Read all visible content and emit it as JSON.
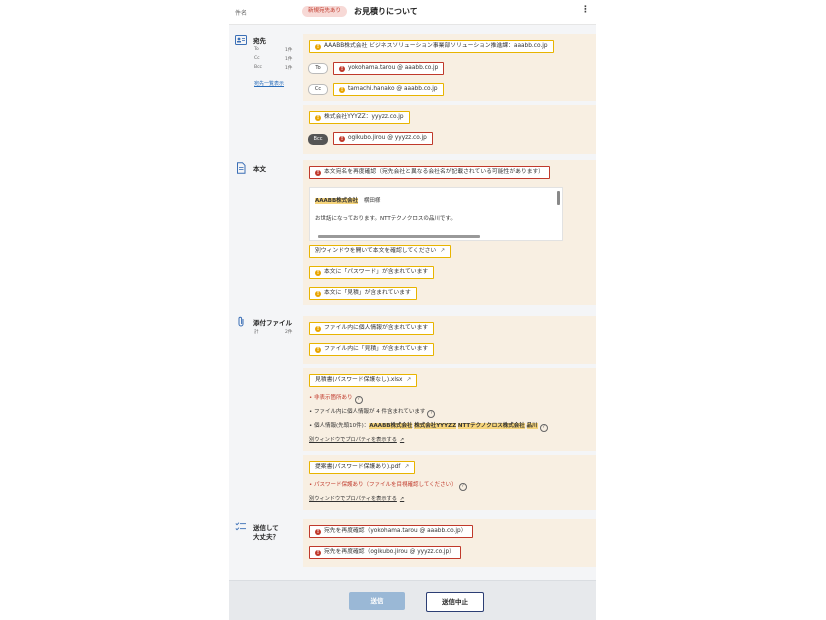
{
  "header": {
    "subject_key": "件名",
    "badge": "新規宛先あり",
    "subject": "お見積りについて",
    "more": "⋮"
  },
  "recipients": {
    "title": "宛先",
    "to_label": "To",
    "to_count": "1件",
    "cc_label": "Cc",
    "cc_count": "1件",
    "bcc_label": "Bcc",
    "bcc_count": "1件",
    "list_link": "宛先一覧表示",
    "group1_header": "AAABB株式会社 ビジネスソリューション事業部ソリューション推進課：aaabb.co.jp",
    "to_pill": "To",
    "to_addr": "yokohama.tarou @ aaabb.co.jp",
    "cc_pill": "Cc",
    "cc_addr": "tamachi.hanako @ aaabb.co.jp",
    "group2_header": "株式会社YYYZZ：yyyzz.co.jp",
    "bcc_pill": "Bcc",
    "bcc_addr": "ogikubo.jirou @ yyyzz.co.jp"
  },
  "body": {
    "title": "本文",
    "warning": "本文宛名を再度確認（宛先会社と異なる会社名が記載されている可能性があります）",
    "preview_company": "AAABB株式会社",
    "preview_name": "横田様",
    "preview_line": "お世話になっております。NTTテクノクロスの品川です。",
    "open_window": "別ウィンドウを開いて本文を確認してください",
    "pw_warning": "本文に「パスワード」が含まれています",
    "quote_warning": "本文に「見積」が含まれています"
  },
  "attachments": {
    "title": "添付ファイル",
    "total_label": "計",
    "total_count": "2件",
    "warn_personal": "ファイル内に個人情報が含まれています",
    "warn_quote": "ファイル内に「見積」が含まれています",
    "file1": {
      "name": "見積書(パスワード保護なし).xlsx",
      "hidden": "非表示箇所あり",
      "personal_count": "ファイル内に個人情報が 4 件含まれています",
      "personal_prefix": "個人情報(先頭10件)：",
      "tags": [
        "AAABB株式会社",
        "株式会社YYYZZ",
        "NTTテクノクロス株式会社",
        "品川"
      ],
      "prop_link": "別ウィンドウでプロパティを表示する"
    },
    "file2": {
      "name": "提案書(パスワード保護あり).pdf",
      "pw_note": "パスワード保護あり（ファイルを目視確認してください）",
      "prop_link": "別ウィンドウでプロパティを表示する"
    }
  },
  "confirm": {
    "title_line1": "送信して",
    "title_line2": "大丈夫？",
    "check1": "宛先を再度確認（yokohama.tarou @ aaabb.co.jp）",
    "check2": "宛先を再度確認（ogikubo.jirou @ yyyzz.co.jp）"
  },
  "footer": {
    "send": "送信",
    "cancel": "送信中止"
  }
}
